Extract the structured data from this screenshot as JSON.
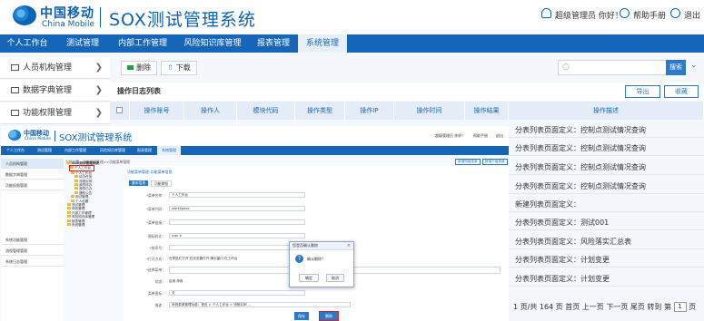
{
  "header": {
    "logo_cn": "中国移动",
    "logo_en": "China Mobile",
    "system_title": "SOX测试管理系统",
    "user_text": "超级管理员 你好！",
    "help_text": "帮助手册",
    "logout_text": "退出"
  },
  "nav": {
    "items": [
      "个人工作台",
      "测试管理",
      "内部工作管理",
      "风险知识库管理",
      "报表管理",
      "系统管理"
    ],
    "active": "系统管理"
  },
  "sidebar": {
    "items": [
      "人员机构管理",
      "数据字典管理",
      "功能权限管理"
    ]
  },
  "toolbar": {
    "delete_label": "删除",
    "download_label": "下载",
    "search_placeholder": "",
    "search_label": "搜索"
  },
  "grid": {
    "title": "操作日志列表",
    "export_label": "导出",
    "collect_label": "收藏",
    "columns": [
      "操作账号",
      "操作人",
      "模块代码",
      "操作类型",
      "操作IP",
      "操作时间",
      "操作结果",
      "操作描述"
    ],
    "row_texts": [
      "分表列表页面定义：控制点测试情况查询",
      "分表列表页面定义：控制点测试情况查询",
      "分表列表页面定义：控制点测试情况查询",
      "分表列表页面定义：控制点测试情况查询",
      "新建列表页面定义：",
      "分表列表页面定义：测试001",
      "分表列表页面定义：风险落实汇总表",
      "分表列表页面定义：计划变更",
      "分表列表页面定义：计划变更"
    ],
    "pager": {
      "prefix": "1 页/共 164 页",
      "first": "首页",
      "prev": "上一页",
      "next": "下一页",
      "last": "尾页",
      "goto": "转到 第",
      "page_value": "1",
      "suffix": "页"
    }
  },
  "inner_screenshot": {
    "header_title": "SOX测试管理系统",
    "logo_cn": "中国移动",
    "logo_en": "China Mobile",
    "header_right": [
      "超级管理员 你好！",
      "帮助手册",
      "退出"
    ],
    "nav": [
      "个人工作台",
      "测试管理",
      "内部工作管理",
      "风险知识库管理",
      "报表管理",
      "系统管理"
    ],
    "sidebar": [
      "人员机构管理",
      "数据字典管理",
      "功能权限管理",
      "系统功能管理",
      "流程管理管理",
      "系统日志管理"
    ],
    "breadcrumb": "当前位置：功能权限管理>>功能菜单管理",
    "top_buttons": [
      "新增同级菜单",
      "新增下级菜单"
    ],
    "tree": [
      "SOX测试管理系统",
      "个人工作台",
      "个人工作台",
      "待办任务",
      "流程实例",
      "我的待办",
      "我的已办",
      "通知公告",
      "测试管理",
      "个人设置",
      "测试管理",
      "风险管理",
      "内部工作管理",
      "风险知识库管理",
      "报表管理",
      "系统管理"
    ],
    "panel_title": "功能菜单管理-功能菜单信息",
    "tabs": [
      "基本信息",
      "功能按钮"
    ],
    "form_labels": [
      "*菜单名称：",
      "*菜单代码：",
      "*菜单链接：",
      "图标样式：",
      "*排序号：",
      "*打开方式：",
      "*选择菜单：",
      "状态：",
      "菜单图标：",
      "描述："
    ],
    "form_values": [
      "个人工作台",
      "workSpace",
      "",
      "icon-h",
      "",
      "在导航栏打开  在浏览器打开  弹出窗口  在工作台",
      "",
      "启用  停用",
      "无",
      "系统菜单管理功能：首页 > 个人工作台 > 流程实例 ..."
    ],
    "save_label": "保存",
    "delete_label": "删除"
  },
  "dialog": {
    "title": "您是否确认删除",
    "message": "确认删除？",
    "ok_label": "确定",
    "cancel_label": "取消"
  }
}
